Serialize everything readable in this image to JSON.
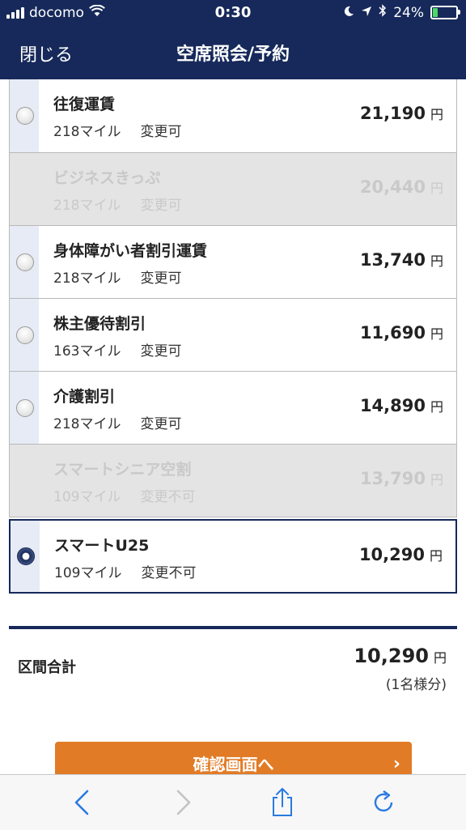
{
  "status": {
    "carrier": "docomo",
    "time": "0:30",
    "battery": "24%",
    "battery_level": 0.24
  },
  "nav": {
    "close_label": "閉じる",
    "title": "空席照会/予約"
  },
  "fares": [
    {
      "name": "往復運賃",
      "miles": "218マイル",
      "change": "変更可",
      "price": "21,190",
      "yen": "円"
    },
    {
      "name": "ビジネスきっぷ",
      "miles": "218マイル",
      "change": "変更可",
      "price": "20,440",
      "yen": "円"
    },
    {
      "name": "身体障がい者割引運賃",
      "miles": "218マイル",
      "change": "変更可",
      "price": "13,740",
      "yen": "円"
    },
    {
      "name": "株主優待割引",
      "miles": "163マイル",
      "change": "変更可",
      "price": "11,690",
      "yen": "円"
    },
    {
      "name": "介護割引",
      "miles": "218マイル",
      "change": "変更可",
      "price": "14,890",
      "yen": "円"
    },
    {
      "name": "スマートシニア空割",
      "miles": "109マイル",
      "change": "変更不可",
      "price": "13,790",
      "yen": "円"
    },
    {
      "name": "スマートU25",
      "miles": "109マイル",
      "change": "変更不可",
      "price": "10,290",
      "yen": "円"
    }
  ],
  "total": {
    "label": "区間合計",
    "price": "10,290",
    "yen": "円",
    "note": "(1名様分)"
  },
  "confirm_label": "確認画面へ",
  "confirm_chevron": "›",
  "colors": {
    "navy": "#16295a",
    "accent": "#e27b26",
    "disabled_bg": "#e4e4e4"
  }
}
